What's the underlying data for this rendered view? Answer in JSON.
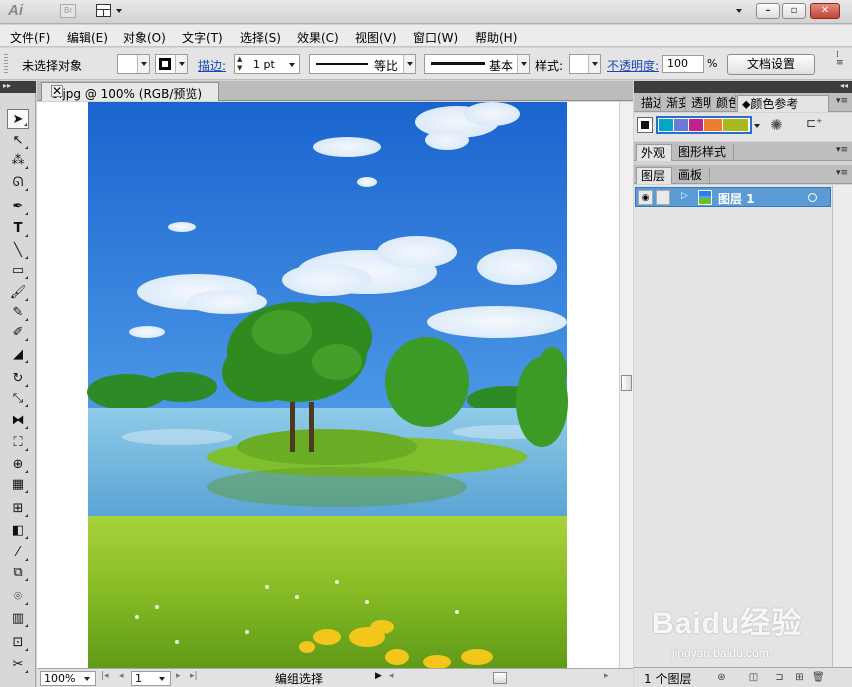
{
  "app": {
    "logo_text": "Ai",
    "bridge_label": "Br"
  },
  "menu": [
    "文件(F)",
    "编辑(E)",
    "对象(O)",
    "文字(T)",
    "选择(S)",
    "效果(C)",
    "视图(V)",
    "窗口(W)",
    "帮助(H)"
  ],
  "control_bar": {
    "selection_status": "未选择对象",
    "stroke_label": "描边:",
    "stroke_weight": "1 pt",
    "stroke_profile": "等比",
    "brush_label": "基本",
    "style_label": "样式:",
    "opacity_label": "不透明度:",
    "opacity_value": "100",
    "opacity_unit": "%",
    "doc_setup_button": "文档设置"
  },
  "document": {
    "tab_title": "6.jpg @ 100% (RGB/预览)",
    "zoom": "100%",
    "artboard_number": "1",
    "status_text": "编组选择"
  },
  "panels": {
    "group1_tabs": [
      "描边",
      "渐变",
      "透明",
      "颜色",
      "颜色参考"
    ],
    "color_guide_swatches": [
      "#111111",
      "#00a8c6",
      "#6b7cd6",
      "#c2228f",
      "#ef7c33",
      "#a8b81f"
    ],
    "group2_tabs": [
      "外观",
      "图形样式"
    ],
    "group3_tabs": [
      "图层",
      "画板"
    ],
    "layer_name": "图层 1",
    "layer_count": "1 个图层"
  },
  "watermark": {
    "brand": "Baidu经验",
    "url": "jingyan.baidu.com"
  },
  "colors": {
    "selected_layer": "#5b9bd5",
    "link_text": "#1a47b8"
  }
}
